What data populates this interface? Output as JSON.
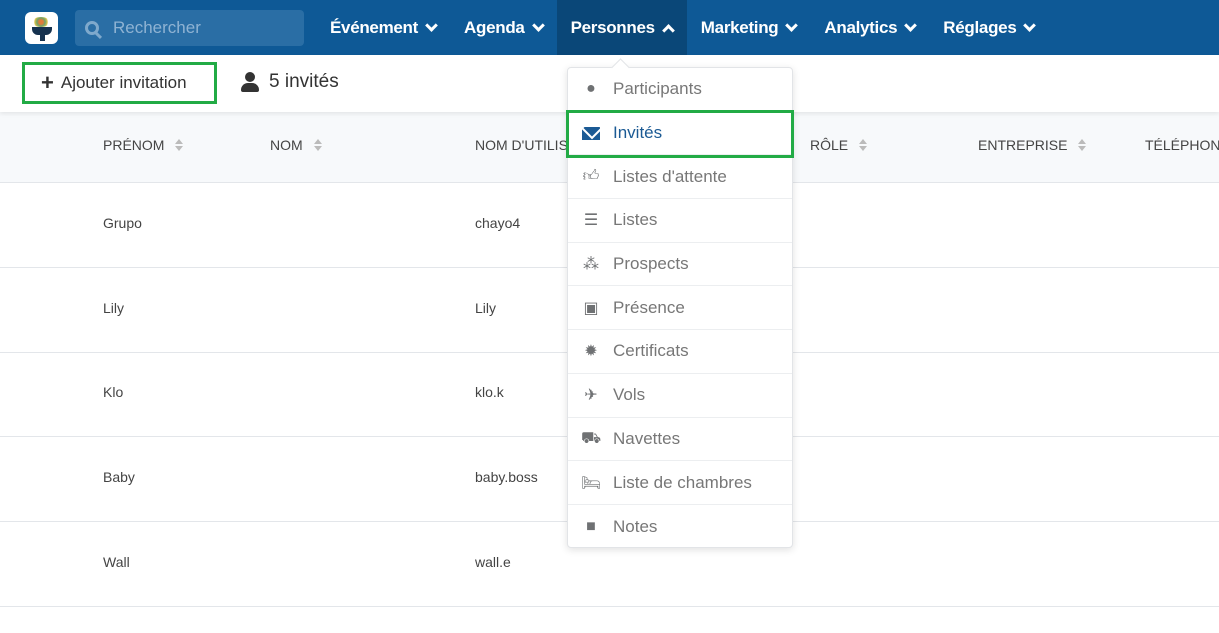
{
  "search": {
    "placeholder": "Rechercher"
  },
  "nav": [
    {
      "label": "Événement"
    },
    {
      "label": "Agenda"
    },
    {
      "label": "Personnes",
      "active": true
    },
    {
      "label": "Marketing"
    },
    {
      "label": "Analytics"
    },
    {
      "label": "Réglages"
    }
  ],
  "toolbar": {
    "add_label": "Ajouter invitation",
    "count_label": "5 invités"
  },
  "table": {
    "columns": [
      "PRÉNOM",
      "NOM",
      "NOM D'UTILISATEUR",
      "RÔLE",
      "ENTREPRISE",
      "TÉLÉPHONE"
    ],
    "rows": [
      {
        "prenom": "Grupo",
        "username": "chayo4"
      },
      {
        "prenom": "Lily",
        "username": "Lily"
      },
      {
        "prenom": "Klo",
        "username": "klo.k"
      },
      {
        "prenom": "Baby",
        "username": "baby.boss"
      },
      {
        "prenom": "Wall",
        "username": "wall.e"
      }
    ]
  },
  "menu": {
    "items": [
      {
        "label": "Participants",
        "icon": "user-icon"
      },
      {
        "label": "Invités",
        "icon": "envelope-icon",
        "selected": true
      },
      {
        "label": "Listes d'attente",
        "icon": "thumbs-up-icon"
      },
      {
        "label": "Listes",
        "icon": "list-icon"
      },
      {
        "label": "Prospects",
        "icon": "users-icon"
      },
      {
        "label": "Présence",
        "icon": "presence-icon"
      },
      {
        "label": "Certificats",
        "icon": "certificate-icon"
      },
      {
        "label": "Vols",
        "icon": "plane-icon"
      },
      {
        "label": "Navettes",
        "icon": "car-icon"
      },
      {
        "label": "Liste de chambres",
        "icon": "bed-icon"
      },
      {
        "label": "Notes",
        "icon": "note-icon"
      }
    ]
  },
  "colors": {
    "header": "#0e5996",
    "active_nav": "#0a4778",
    "highlight": "#22ab45",
    "selected_text": "#1b5a94"
  }
}
